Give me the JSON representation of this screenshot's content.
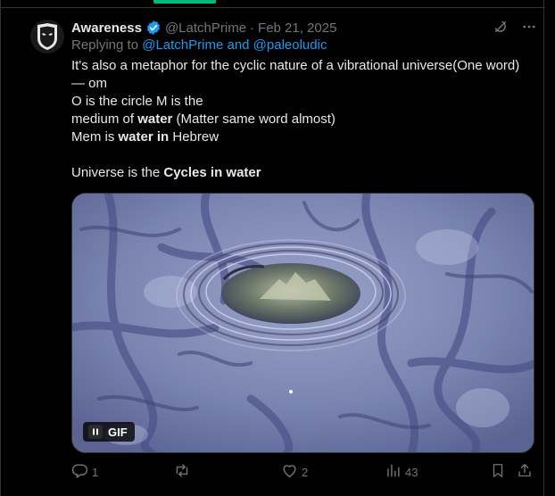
{
  "tweet": {
    "author_name": "Awareness",
    "handle": "@LatchPrime",
    "separator": "·",
    "date": "Feb 21, 2025",
    "reply_prefix": "Replying to",
    "reply_mentions": "@LatchPrime and @paleoludic",
    "text": {
      "line1": "It's also a metaphor for the cyclic nature of a vibrational universe(One word)",
      "line2": "— om",
      "line3": "O is the circle M is the",
      "line4_a": "medium of ",
      "line4_b": "water",
      "line4_c": " (Matter same word almost)",
      "line5_a": "Mem is ",
      "line5_b": "water in",
      "line5_c": " Hebrew",
      "line7_a": "Universe is the ",
      "line7_b": "Cycles in water"
    },
    "media": {
      "badge": "GIF"
    },
    "actions": {
      "replies": "1",
      "retweets": "",
      "likes": "2",
      "views": "43"
    }
  },
  "colors": {
    "background": "#000000",
    "text": "#e7e9ea",
    "muted": "#71767b",
    "link": "#1d9bf0",
    "verified": "#1d9bf0",
    "accent": "#00ba7c",
    "border": "#2f3336"
  },
  "icons": {
    "avatar": "alien-mask-icon",
    "verified": "verified-badge-icon",
    "grok": "grok-icon",
    "more": "more-icon",
    "pause": "pause-icon",
    "reply": "reply-icon",
    "retweet": "retweet-icon",
    "like": "heart-icon",
    "views": "views-icon",
    "bookmark": "bookmark-icon",
    "share": "share-icon"
  }
}
